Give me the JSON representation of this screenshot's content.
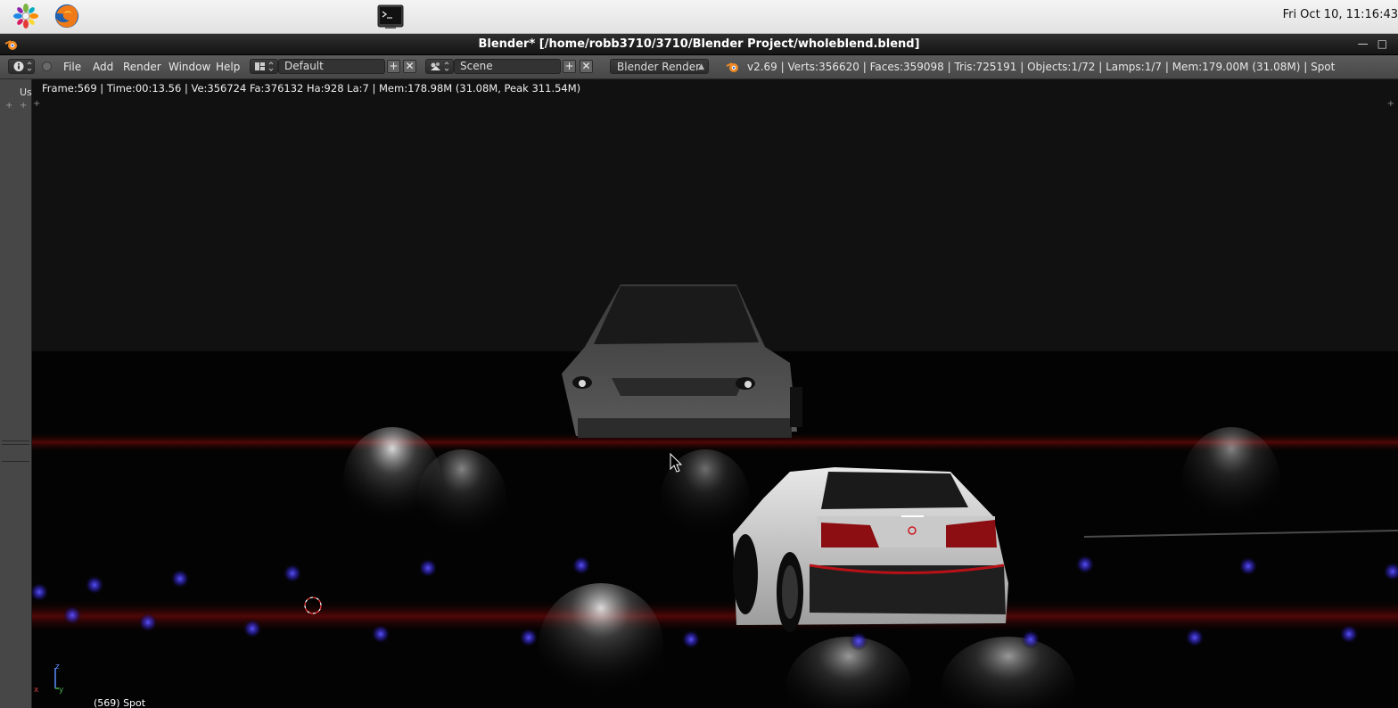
{
  "taskbar": {
    "apps": [
      {
        "name": "applications-menu",
        "icon": "gnome-foot-icon"
      },
      {
        "name": "firefox",
        "icon": "firefox-icon"
      },
      {
        "name": "terminal",
        "icon": "terminal-icon"
      }
    ],
    "clock": "Fri Oct 10, 11:16:43"
  },
  "window": {
    "title": "Blender* [/home/robb3710/3710/Blender Project/wholeblend.blend]"
  },
  "menubar": {
    "menus": [
      "File",
      "Add",
      "Render",
      "Window",
      "Help"
    ],
    "layout": "Default",
    "scene": "Scene",
    "engine": "Blender Render",
    "stats": "v2.69 | Verts:356620 | Faces:359098 | Tris:725191 | Objects:1/72 | Lamps:1/7 | Mem:179.00M (31.08M) | Spot"
  },
  "left_panel": {
    "tab_label": "Us"
  },
  "viewport": {
    "render_info": "Frame:569 | Time:00:13.56 | Ve:356724 Fa:376132 Ha:928 La:7 | Mem:178.98M (31.08M, Peak 311.54M)",
    "object_label": "(569) Spot",
    "axis_labels": [
      "z",
      "x",
      "z",
      "y"
    ]
  },
  "colors": {
    "accent": "#e87d0d",
    "menubar": "#545454",
    "viewport": "#000000"
  }
}
